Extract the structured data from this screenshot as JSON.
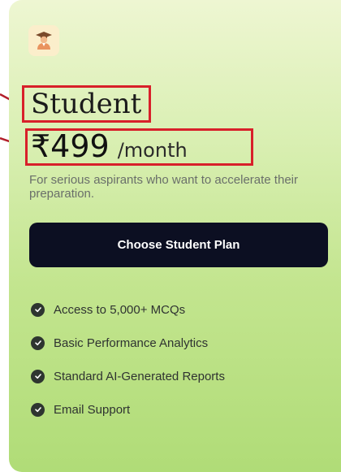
{
  "plan": {
    "name": "Student",
    "price": "₹499",
    "period": "/month",
    "description": "For serious aspirants who want to accelerate their preparation.",
    "cta_label": "Choose Student Plan",
    "avatar_icon": "student-graduate-icon",
    "features": [
      "Access to 5,000+ MCQs",
      "Basic Performance Analytics",
      "Standard AI-Generated Reports",
      "Email Support"
    ]
  },
  "colors": {
    "card_top": "#eef6d2",
    "card_bottom": "#b0dc77",
    "button_bg": "#0c0f22",
    "annotation": "#d8202a",
    "check_bg": "#2e3530"
  }
}
